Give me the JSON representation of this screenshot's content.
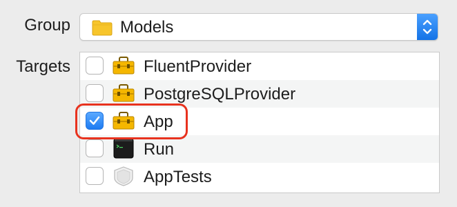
{
  "group": {
    "label": "Group",
    "value": "Models"
  },
  "targets": {
    "label": "Targets",
    "items": [
      {
        "name": "FluentProvider",
        "checked": false,
        "icon": "toolbox-icon"
      },
      {
        "name": "PostgreSQLProvider",
        "checked": false,
        "icon": "toolbox-icon"
      },
      {
        "name": "App",
        "checked": true,
        "icon": "toolbox-icon"
      },
      {
        "name": "Run",
        "checked": false,
        "icon": "terminal-icon"
      },
      {
        "name": "AppTests",
        "checked": false,
        "icon": "test-bundle-icon"
      }
    ]
  },
  "colors": {
    "accent": "#1e7cf2",
    "highlight": "#e8321e",
    "toolbox": "#f5b700"
  }
}
